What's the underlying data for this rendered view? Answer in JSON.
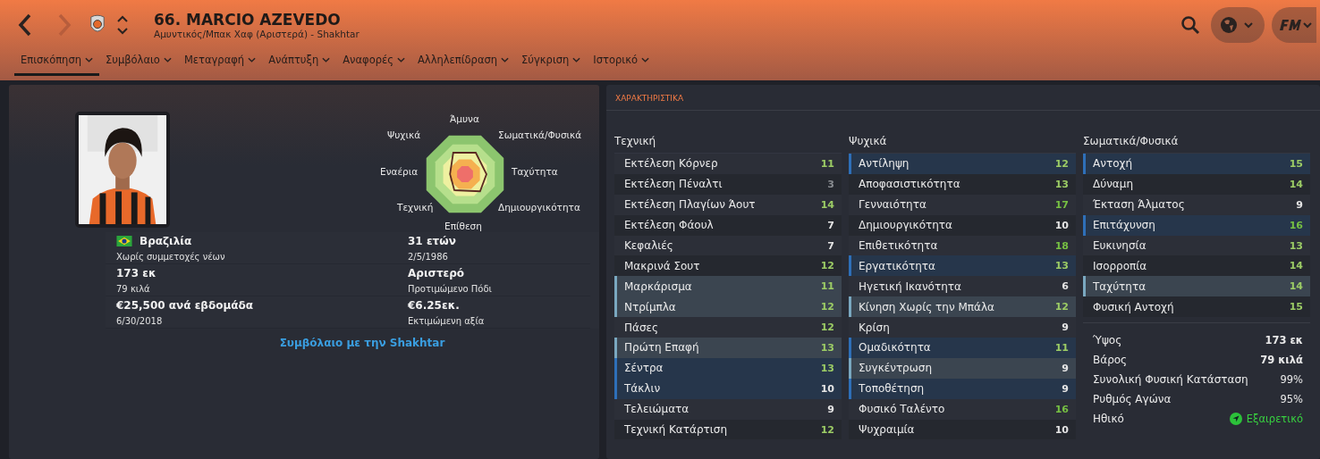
{
  "header": {
    "title": "66. MARCIO AZEVEDO",
    "subtitle": "Αμυντικός/Μπακ Χαφ (Αριστερά) - Shakhtar"
  },
  "tabs": [
    {
      "label": "Επισκόπηση",
      "selected": true
    },
    {
      "label": "Συμβόλαιο",
      "selected": false
    },
    {
      "label": "Μεταγραφή",
      "selected": false
    },
    {
      "label": "Ανάπτυξη",
      "selected": false
    },
    {
      "label": "Αναφορές",
      "selected": false
    },
    {
      "label": "Αλληλεπίδραση",
      "selected": false
    },
    {
      "label": "Σύγκριση",
      "selected": false
    },
    {
      "label": "Ιστορικό",
      "selected": false
    }
  ],
  "profile": {
    "radar_labels": [
      "Άμυνα",
      "Ψυχικά",
      "Σωματικά/Φυσικά",
      "Εναέρια",
      "Ταχύτητα",
      "Τεχνική",
      "Δημιουργικότητα",
      "Επίθεση"
    ],
    "info": [
      {
        "main": "Βραζιλία",
        "sub": "Χωρίς συμμετοχές νέων",
        "kind": "country"
      },
      {
        "main": "31 ετών",
        "sub": "2/5/1986",
        "kind": "plain"
      },
      {
        "main": "173 εκ",
        "sub": "79 κιλά",
        "kind": "plain"
      },
      {
        "main": "Αριστερό",
        "sub": "Προτιμώμενο Πόδι",
        "kind": "plain"
      },
      {
        "main": "€25,500 ανά εβδομάδα",
        "sub": "6/30/2018",
        "kind": "plain"
      },
      {
        "main": "€6.25εκ.",
        "sub": "Εκτιμώμενη αξία",
        "kind": "plain"
      }
    ],
    "contract_link": "Συμβόλαιο με την Shakhtar"
  },
  "attributes": {
    "title": "ΧΑΡΑΚΤΗΡΙΣΤΙΚΑ",
    "groups": [
      {
        "name": "Τεχνική",
        "rows": [
          {
            "name": "Εκτέλεση Κόρνερ",
            "value": "11",
            "kind": "plain"
          },
          {
            "name": "Εκτέλεση Πέναλτι",
            "value": "3",
            "kind": "plain"
          },
          {
            "name": "Εκτέλεση Πλαγίων Άουτ",
            "value": "14",
            "kind": "plain"
          },
          {
            "name": "Εκτέλεση Φάουλ",
            "value": "7",
            "kind": "plain"
          },
          {
            "name": "Κεφαλιές",
            "value": "7",
            "kind": "plain"
          },
          {
            "name": "Μακρινά Σουτ",
            "value": "12",
            "kind": "plain"
          },
          {
            "name": "Μαρκάρισμα",
            "value": "11",
            "kind": "useful"
          },
          {
            "name": "Ντρίμπλα",
            "value": "12",
            "kind": "useful"
          },
          {
            "name": "Πάσες",
            "value": "12",
            "kind": "plain"
          },
          {
            "name": "Πρώτη Επαφή",
            "value": "13",
            "kind": "useful"
          },
          {
            "name": "Σέντρα",
            "value": "13",
            "kind": "key"
          },
          {
            "name": "Τάκλιν",
            "value": "10",
            "kind": "key"
          },
          {
            "name": "Τελειώματα",
            "value": "9",
            "kind": "plain"
          },
          {
            "name": "Τεχνική Κατάρτιση",
            "value": "12",
            "kind": "plain"
          }
        ]
      },
      {
        "name": "Ψυχικά",
        "rows": [
          {
            "name": "Αντίληψη",
            "value": "12",
            "kind": "key"
          },
          {
            "name": "Αποφασιστικότητα",
            "value": "13",
            "kind": "plain"
          },
          {
            "name": "Γενναιότητα",
            "value": "17",
            "kind": "plain"
          },
          {
            "name": "Δημιουργικότητα",
            "value": "10",
            "kind": "plain"
          },
          {
            "name": "Επιθετικότητα",
            "value": "18",
            "kind": "plain"
          },
          {
            "name": "Εργατικότητα",
            "value": "13",
            "kind": "key"
          },
          {
            "name": "Ηγετική Ικανότητα",
            "value": "6",
            "kind": "plain"
          },
          {
            "name": "Κίνηση Χωρίς την Μπάλα",
            "value": "12",
            "kind": "useful"
          },
          {
            "name": "Κρίση",
            "value": "9",
            "kind": "plain"
          },
          {
            "name": "Ομαδικότητα",
            "value": "11",
            "kind": "key"
          },
          {
            "name": "Συγκέντρωση",
            "value": "9",
            "kind": "useful"
          },
          {
            "name": "Τοποθέτηση",
            "value": "9",
            "kind": "key"
          },
          {
            "name": "Φυσικό Ταλέντο",
            "value": "16",
            "kind": "plain"
          },
          {
            "name": "Ψυχραιμία",
            "value": "10",
            "kind": "plain"
          }
        ]
      },
      {
        "name": "Σωματικά/Φυσικά",
        "rows": [
          {
            "name": "Αντοχή",
            "value": "15",
            "kind": "key"
          },
          {
            "name": "Δύναμη",
            "value": "14",
            "kind": "plain"
          },
          {
            "name": "Έκταση Άλματος",
            "value": "9",
            "kind": "plain"
          },
          {
            "name": "Επιτάχυνση",
            "value": "16",
            "kind": "key"
          },
          {
            "name": "Ευκινησία",
            "value": "13",
            "kind": "plain"
          },
          {
            "name": "Ισορροπία",
            "value": "14",
            "kind": "plain"
          },
          {
            "name": "Ταχύτητα",
            "value": "14",
            "kind": "useful"
          },
          {
            "name": "Φυσική Αντοχή",
            "value": "15",
            "kind": "plain"
          }
        ]
      }
    ],
    "facts": [
      {
        "label": "Ύψος",
        "value": "173 εκ",
        "kind": "bold"
      },
      {
        "label": "Βάρος",
        "value": "79 κιλά",
        "kind": "bold"
      },
      {
        "label": "Συνολική Φυσική Κατάσταση",
        "value": "99%",
        "kind": "plain"
      },
      {
        "label": "Ρυθμός Αγώνα",
        "value": "95%",
        "kind": "plain"
      },
      {
        "label": "Ηθικό",
        "value": "Εξαιρετικό",
        "kind": "morale"
      }
    ]
  }
}
